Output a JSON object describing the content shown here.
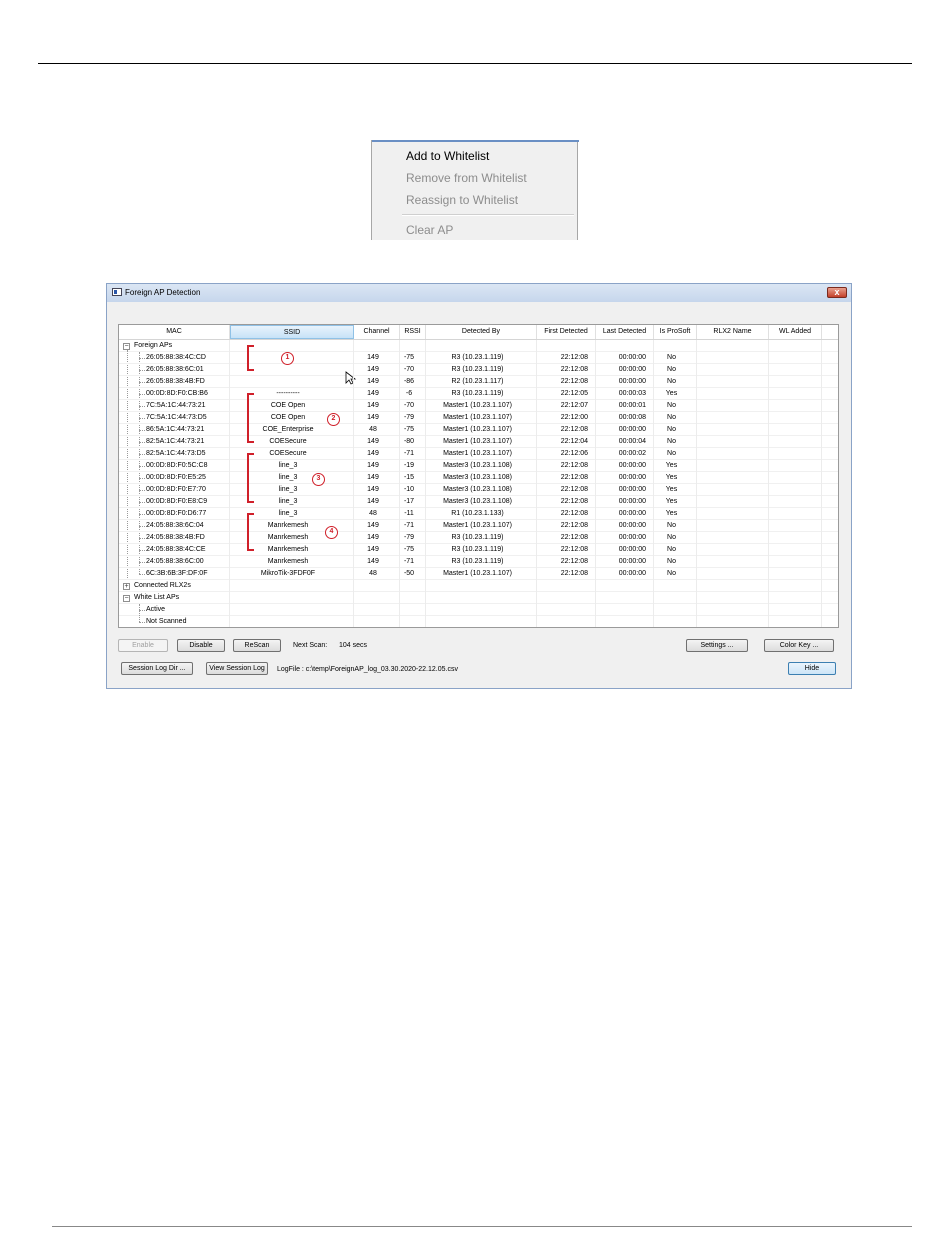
{
  "context_menu": {
    "items": [
      {
        "label": "Add to Whitelist",
        "enabled": true
      },
      {
        "label": "Remove from Whitelist",
        "enabled": false
      },
      {
        "label": "Reassign to Whitelist",
        "enabled": false
      },
      {
        "label": "Clear AP",
        "enabled": false
      }
    ]
  },
  "window": {
    "title": "Foreign AP Detection",
    "close_label": "x"
  },
  "grid": {
    "columns": [
      "MAC",
      "SSID",
      "Channel",
      "RSSI",
      "Detected By",
      "First Detected",
      "Last Detected",
      "Is ProSoft",
      "RLX2 Name",
      "WL Added"
    ],
    "groups": {
      "foreign": "Foreign APs",
      "connected": "Connected RLX2s",
      "whitelist": "White List APs",
      "active": "Active",
      "not_scanned": "Not Scanned"
    },
    "rows": [
      [
        "26:05:88:38:4C:CD",
        "",
        "149",
        "-75",
        "R3 (10.23.1.119)",
        "22:12:08",
        "00:00:00",
        "No"
      ],
      [
        "26:05:88:38:6C:01",
        "",
        "149",
        "-70",
        "R3 (10.23.1.119)",
        "22:12:08",
        "00:00:00",
        "No"
      ],
      [
        "26:05:88:38:4B:FD",
        "",
        "149",
        "-86",
        "R2 (10.23.1.117)",
        "22:12:08",
        "00:00:00",
        "No"
      ],
      [
        "00:0D:8D:F0:CB:B6",
        "----------",
        "149",
        "-6",
        "R3 (10.23.1.119)",
        "22:12:05",
        "00:00:03",
        "Yes"
      ],
      [
        "7C:5A:1C:44:73:21",
        "COE Open",
        "149",
        "-70",
        "Master1 (10.23.1.107)",
        "22:12:07",
        "00:00:01",
        "No"
      ],
      [
        "7C:5A:1C:44:73:D5",
        "COE Open",
        "149",
        "-79",
        "Master1 (10.23.1.107)",
        "22:12:00",
        "00:00:08",
        "No"
      ],
      [
        "86:5A:1C:44:73:21",
        "COE_Enterprise",
        "48",
        "-75",
        "Master1 (10.23.1.107)",
        "22:12:08",
        "00:00:00",
        "No"
      ],
      [
        "82:5A:1C:44:73:21",
        "COESecure",
        "149",
        "-80",
        "Master1 (10.23.1.107)",
        "22:12:04",
        "00:00:04",
        "No"
      ],
      [
        "82:5A:1C:44:73:D5",
        "COESecure",
        "149",
        "-71",
        "Master1 (10.23.1.107)",
        "22:12:06",
        "00:00:02",
        "No"
      ],
      [
        "00:0D:8D:F0:5C:C8",
        "line_3",
        "149",
        "-19",
        "Master3 (10.23.1.108)",
        "22:12:08",
        "00:00:00",
        "Yes"
      ],
      [
        "00:0D:8D:F0:E5:25",
        "line_3",
        "149",
        "-15",
        "Master3 (10.23.1.108)",
        "22:12:08",
        "00:00:00",
        "Yes"
      ],
      [
        "00:0D:8D:F0:E7:70",
        "line_3",
        "149",
        "-10",
        "Master3 (10.23.1.108)",
        "22:12:08",
        "00:00:00",
        "Yes"
      ],
      [
        "00:0D:8D:F0:E8:C9",
        "line_3",
        "149",
        "-17",
        "Master3 (10.23.1.108)",
        "22:12:08",
        "00:00:00",
        "Yes"
      ],
      [
        "00:0D:8D:F0:D6:77",
        "line_3",
        "48",
        "-11",
        "R1 (10.23.1.133)",
        "22:12:08",
        "00:00:00",
        "Yes"
      ],
      [
        "24:05:88:38:6C:04",
        "Manrkemesh",
        "149",
        "-71",
        "Master1 (10.23.1.107)",
        "22:12:08",
        "00:00:00",
        "No"
      ],
      [
        "24:05:88:38:4B:FD",
        "Manrkemesh",
        "149",
        "-79",
        "R3 (10.23.1.119)",
        "22:12:08",
        "00:00:00",
        "No"
      ],
      [
        "24:05:88:38:4C:CE",
        "Manrkemesh",
        "149",
        "-75",
        "R3 (10.23.1.119)",
        "22:12:08",
        "00:00:00",
        "No"
      ],
      [
        "24:05:88:38:6C:00",
        "Manrkemesh",
        "149",
        "-71",
        "R3 (10.23.1.119)",
        "22:12:08",
        "00:00:00",
        "No"
      ],
      [
        "6C:3B:6B:3F:DF:0F",
        "MikroTik-3FDF0F",
        "48",
        "-50",
        "Master1 (10.23.1.107)",
        "22:12:08",
        "00:00:00",
        "No"
      ]
    ]
  },
  "annotations": [
    "1",
    "2",
    "3",
    "4"
  ],
  "controls": {
    "enable": "Enable",
    "disable": "Disable",
    "rescan": "ReScan",
    "next_scan_label": "Next Scan:",
    "next_scan_value": "104 secs",
    "settings": "Settings ...",
    "color_key": "Color Key ...",
    "session_log_dir": "Session Log Dir ...",
    "view_session_log": "View Session Log",
    "logfile": "LogFile : c:\\temp\\ForeignAP_log_03.30.2020-22.12.05.csv",
    "hide": "Hide"
  },
  "colors": {
    "annotation": "#d0202a",
    "header_selected": "#c7e2f7",
    "title_bar": "#c6d6ec"
  }
}
